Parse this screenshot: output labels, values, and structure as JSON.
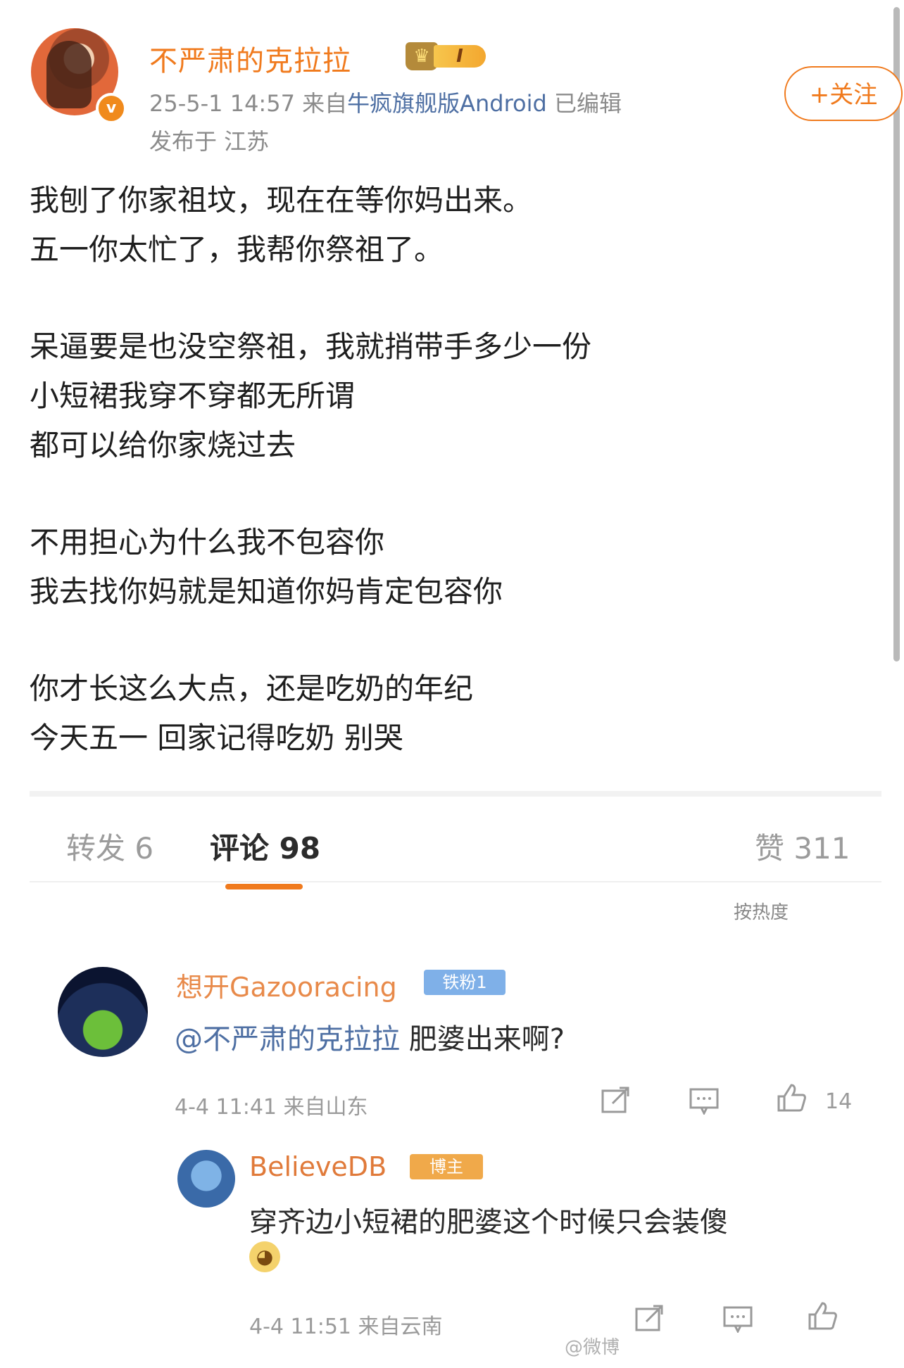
{
  "post": {
    "username": "不严肃的克拉拉",
    "vip_level": "I",
    "timestamp": "25-5-1 14:57",
    "source_prefix": "来自",
    "source": "牛疯旗舰版Android",
    "edited": "已编辑",
    "location": "发布于 江苏",
    "follow_label": "+关注",
    "lines": [
      "我刨了你家祖坟，现在在等你妈出来。",
      "五一你太忙了，我帮你祭祖了。",
      "呆逼要是也没空祭祖，我就捎带手多少一份",
      "小短裙我穿不穿都无所谓",
      "都可以给你家烧过去",
      "不用担心为什么我不包容你",
      "我去找你妈就是知道你妈肯定包容你",
      "你才长这么大点，还是吃奶的年纪",
      "今天五一 回家记得吃奶 别哭"
    ]
  },
  "embed": {
    "tabs": {
      "repost": "转发 6",
      "comments": "评论 98",
      "likes": "赞 311"
    },
    "sort_label": "按热度",
    "comment1": {
      "name": "想开Gazooracing",
      "badge": "铁粉1",
      "mention": "@不严肃的克拉拉",
      "text": " 肥婆出来啊?",
      "meta": "4-4 11:41 来自山东",
      "likes": "14"
    },
    "comment2": {
      "name": "BelieveDB",
      "badge": "博主",
      "text": "穿齐边小短裙的肥婆这个时候只会装傻",
      "meta": "4-4 11:51 来自云南"
    },
    "watermark": "@微博"
  },
  "colors": {
    "accent": "#f07a1d",
    "link": "#4e6fa3",
    "meta": "#8b8b8b"
  }
}
